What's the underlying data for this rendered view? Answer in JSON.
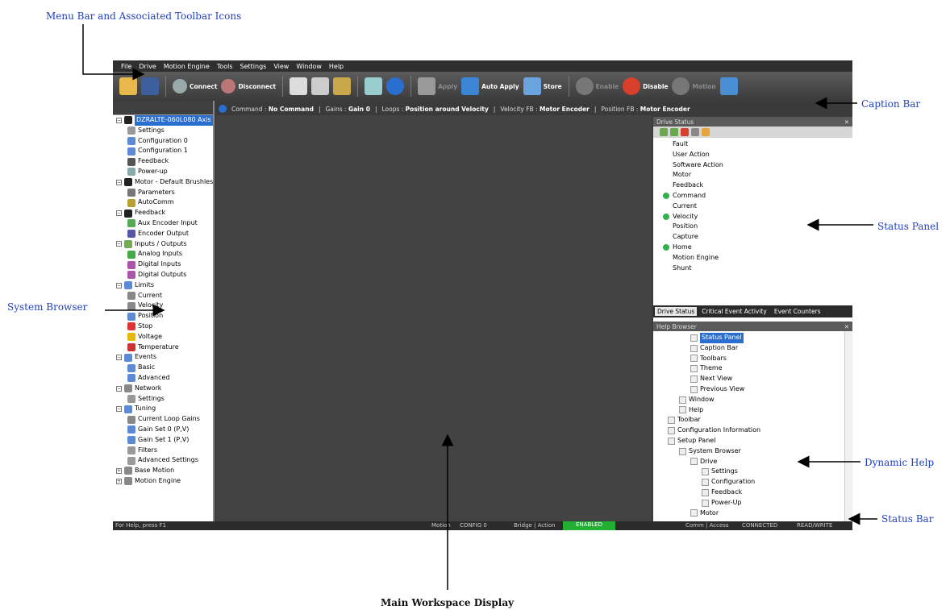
{
  "callouts": {
    "menu_bar": "Menu Bar and Associated Toolbar Icons",
    "caption_bar": "Caption Bar",
    "status_panel": "Status Panel",
    "system_browser": "System Browser",
    "dynamic_help": "Dynamic Help",
    "status_bar": "Status Bar",
    "main_workspace": "Main Workspace Display"
  },
  "menu": [
    "File",
    "Drive",
    "Motion Engine",
    "Tools",
    "Settings",
    "View",
    "Window",
    "Help"
  ],
  "toolbar": {
    "connect": "Connect",
    "disconnect": "Disconnect",
    "apply": "Apply",
    "auto_apply": "Auto Apply",
    "store": "Store",
    "enable": "Enable",
    "disable": "Disable",
    "motion": "Motion"
  },
  "caption": {
    "command_label": "Command :",
    "command_value": "No Command",
    "gains_label": "Gains :",
    "gains_value": "Gain 0",
    "loops_label": "Loops :",
    "loops_value": "Position around Velocity",
    "velfb_label": "Velocity FB :",
    "velfb_value": "Motor Encoder",
    "posfb_label": "Position FB :",
    "posfb_value": "Motor Encoder"
  },
  "system_browser": {
    "items": [
      {
        "label": "DZRALTE-060L080 Axis",
        "level": 0,
        "toggle": "-",
        "color": "#222"
      },
      {
        "label": "Settings",
        "level": 1,
        "color": "#999"
      },
      {
        "label": "Configuration 0",
        "level": 1,
        "color": "#5b8bd6"
      },
      {
        "label": "Configuration 1",
        "level": 1,
        "color": "#5b8bd6"
      },
      {
        "label": "Feedback",
        "level": 1,
        "color": "#555"
      },
      {
        "label": "Power-up",
        "level": 1,
        "color": "#8aa"
      },
      {
        "label": "Motor - Default Brushless",
        "level": 0,
        "toggle": "-",
        "color": "#222"
      },
      {
        "label": "Parameters",
        "level": 1,
        "color": "#777"
      },
      {
        "label": "AutoComm",
        "level": 1,
        "color": "#b9a030"
      },
      {
        "label": "Feedback",
        "level": 0,
        "toggle": "-",
        "color": "#222"
      },
      {
        "label": "Aux Encoder Input",
        "level": 1,
        "color": "#5a5"
      },
      {
        "label": "Encoder Output",
        "level": 1,
        "color": "#55a"
      },
      {
        "label": "Inputs / Outputs",
        "level": 0,
        "toggle": "-",
        "color": "#7a5"
      },
      {
        "label": "Analog Inputs",
        "level": 1,
        "color": "#4a4"
      },
      {
        "label": "Digital Inputs",
        "level": 1,
        "color": "#a5a"
      },
      {
        "label": "Digital Outputs",
        "level": 1,
        "color": "#a5a"
      },
      {
        "label": "Limits",
        "level": 0,
        "toggle": "-",
        "color": "#5b8bd6"
      },
      {
        "label": "Current",
        "level": 1,
        "color": "#888"
      },
      {
        "label": "Velocity",
        "level": 1,
        "color": "#888"
      },
      {
        "label": "Position",
        "level": 1,
        "color": "#5b8bd6"
      },
      {
        "label": "Stop",
        "level": 1,
        "color": "#d33"
      },
      {
        "label": "Voltage",
        "level": 1,
        "color": "#e6b800"
      },
      {
        "label": "Temperature",
        "level": 1,
        "color": "#c33"
      },
      {
        "label": "Events",
        "level": 0,
        "toggle": "-",
        "color": "#5b8bd6"
      },
      {
        "label": "Basic",
        "level": 1,
        "color": "#5b8bd6"
      },
      {
        "label": "Advanced",
        "level": 1,
        "color": "#5b8bd6"
      },
      {
        "label": "Network",
        "level": 0,
        "toggle": "-",
        "color": "#888"
      },
      {
        "label": "Settings",
        "level": 1,
        "color": "#999"
      },
      {
        "label": "Tuning",
        "level": 0,
        "toggle": "-",
        "color": "#5b8bd6"
      },
      {
        "label": "Current Loop Gains",
        "level": 1,
        "color": "#888"
      },
      {
        "label": "Gain Set 0 (P,V)",
        "level": 1,
        "color": "#5b8bd6"
      },
      {
        "label": "Gain Set 1 (P,V)",
        "level": 1,
        "color": "#5b8bd6"
      },
      {
        "label": "Filters",
        "level": 1,
        "color": "#999"
      },
      {
        "label": "Advanced Settings",
        "level": 1,
        "color": "#999"
      },
      {
        "label": "Base Motion",
        "level": 0,
        "toggle": "+",
        "color": "#888"
      },
      {
        "label": "Motion Engine",
        "level": 0,
        "toggle": "+",
        "color": "#888"
      }
    ]
  },
  "drive_status": {
    "title": "Drive Status",
    "items": [
      {
        "label": "Fault",
        "dot": false
      },
      {
        "label": "User Action",
        "dot": false
      },
      {
        "label": "Software Action",
        "dot": false
      },
      {
        "label": "Motor",
        "dot": false
      },
      {
        "label": "Feedback",
        "dot": false
      },
      {
        "label": "Command",
        "dot": true
      },
      {
        "label": "Current",
        "dot": false
      },
      {
        "label": "Velocity",
        "dot": true
      },
      {
        "label": "Position",
        "dot": false
      },
      {
        "label": "Capture",
        "dot": false
      },
      {
        "label": "Home",
        "dot": true
      },
      {
        "label": "Motion Engine",
        "dot": false
      },
      {
        "label": "Shunt",
        "dot": false
      }
    ],
    "tabs": [
      "Drive Status",
      "Critical Event Activity",
      "Event Counters"
    ]
  },
  "help_browser": {
    "title": "Help Browser",
    "items": [
      {
        "label": "Status Panel",
        "level": 3,
        "selected": true
      },
      {
        "label": "Caption Bar",
        "level": 3
      },
      {
        "label": "Toolbars",
        "level": 3
      },
      {
        "label": "Theme",
        "level": 3
      },
      {
        "label": "Next View",
        "level": 3
      },
      {
        "label": "Previous View",
        "level": 3
      },
      {
        "label": "Window",
        "level": 2
      },
      {
        "label": "Help",
        "level": 2
      },
      {
        "label": "Toolbar",
        "level": 1
      },
      {
        "label": "Configuration Information",
        "level": 1
      },
      {
        "label": "Setup Panel",
        "level": 1
      },
      {
        "label": "System Browser",
        "level": 2
      },
      {
        "label": "Drive",
        "level": 3
      },
      {
        "label": "Settings",
        "level": 4
      },
      {
        "label": "Configuration",
        "level": 4
      },
      {
        "label": "Feedback",
        "level": 4
      },
      {
        "label": "Power-Up",
        "level": 4
      },
      {
        "label": "Motor",
        "level": 3
      }
    ]
  },
  "statusbar": {
    "help": "For Help, press F1",
    "motion": "Motion",
    "config": "CONFIG 0",
    "bridge": "Bridge | Action",
    "enabled": "ENABLED",
    "comm": "Comm | Access",
    "connected": "CONNECTED",
    "readwrite": "READ/WRITE"
  },
  "colors": {
    "accent": "#2a6fd0",
    "enabled": "#22b033",
    "callout": "#1f3fbf"
  }
}
